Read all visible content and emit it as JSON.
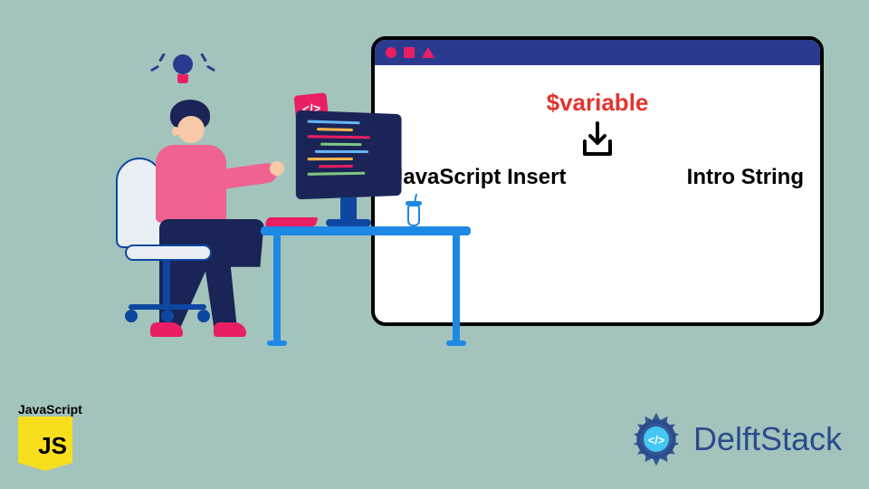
{
  "js_logo": {
    "label": "JavaScript"
  },
  "delft": {
    "name": "DelftStack"
  },
  "window": {
    "variable": "$variable",
    "left_text": "JavaScript Insert",
    "right_text": "Intro String"
  },
  "code_badge": "</>"
}
